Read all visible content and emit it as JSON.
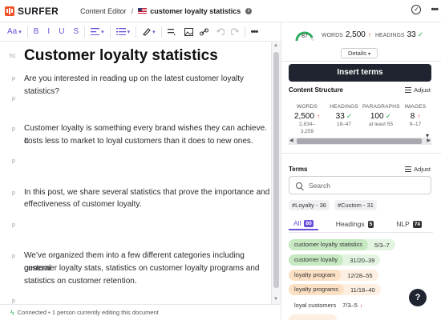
{
  "header": {
    "logo_text": "SURFER",
    "section": "Content Editor",
    "separator": "/",
    "doc_title": "customer loyalty statistics"
  },
  "toolbar": {
    "font_label": "Aa",
    "bold": "B",
    "italic": "I",
    "underline": "U",
    "strike": "S"
  },
  "editor": {
    "h1_label": "h1",
    "p_label": "p",
    "title": "Customer loyalty statistics",
    "lines": [
      "Are you interested in reading up on the latest customer loyalty statistics?",
      "Customer loyalty is something every brand wishes they can achieve. It",
      "costs less to market to loyal customers than it does to new ones.",
      "In this post, we share several statistics that prove the importance and",
      "effectiveness of customer loyalty.",
      "We’ve organized them into a few different categories including general",
      "customer loyalty stats, statistics on customer loyalty programs and",
      "statistics on customer retention."
    ]
  },
  "status": {
    "text": "Connected • 1 person currently editing this document"
  },
  "panel": {
    "score": "87",
    "score_value": 0.87,
    "words_label": "WORDS",
    "words_value": "2,500",
    "headings_label": "HEADINGS",
    "headings_value": "33",
    "details": "Details",
    "insert_terms": "Insert terms",
    "content_structure": "Content Structure",
    "adjust": "Adjust",
    "structure": [
      {
        "label": "WORDS",
        "value": "2,500",
        "sub1": "2,834–",
        "sub2": "3,259",
        "indicator": "up"
      },
      {
        "label": "HEADINGS",
        "value": "33",
        "sub1": "18–47",
        "sub2": "",
        "indicator": "ok"
      },
      {
        "label": "PARAGRAPHS",
        "value": "100",
        "sub1": "at least 55",
        "sub2": "",
        "indicator": "ok"
      },
      {
        "label": "IMAGES",
        "value": "8",
        "sub1": "9–17",
        "sub2": "",
        "indicator": "up"
      }
    ],
    "terms_title": "Terms",
    "search_placeholder": "Search",
    "filters": [
      "#Loyalty - 36",
      "#Custom - 31"
    ],
    "tabs": [
      {
        "label": "All",
        "count": "80"
      },
      {
        "label": "Headings",
        "count": "5"
      },
      {
        "label": "NLP",
        "count": "74"
      }
    ],
    "terms": [
      {
        "name": "customer loyalty statistics",
        "count": "5/3–7",
        "status": "green",
        "arrow": ""
      },
      {
        "name": "customer loyalty",
        "count": "31/20–39",
        "status": "green",
        "arrow": ""
      },
      {
        "name": "loyalty program",
        "count": "12/28–55",
        "status": "orange",
        "arrow": ""
      },
      {
        "name": "loyalty programs",
        "count": "11/18–40",
        "status": "orange",
        "arrow": ""
      },
      {
        "name": "loyal customers",
        "count": "7/3–5",
        "status": "plain",
        "arrow": "↓"
      }
    ],
    "help": "?"
  },
  "colors": {
    "accent": "#6b4fd8",
    "brand": "#f04e23",
    "good": "#2fae5d",
    "bad": "#e53935",
    "dark_button": "#1f2430"
  }
}
